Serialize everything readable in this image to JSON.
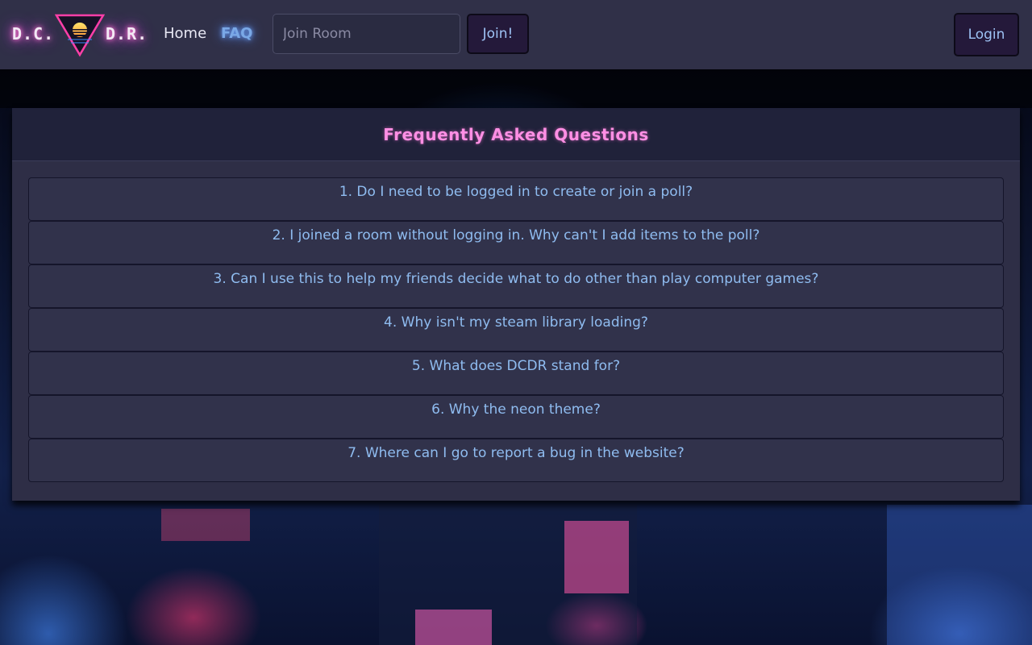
{
  "navbar": {
    "brand_left": "D.C.",
    "brand_right": "D.R.",
    "home_label": "Home",
    "faq_label": "FAQ",
    "join_placeholder": "Join Room",
    "join_button": "Join!",
    "login_button": "Login"
  },
  "faq": {
    "title": "Frequently Asked Questions",
    "questions": [
      "1. Do I need to be logged in to create or join a poll?",
      "2. I joined a room without logging in. Why can't I add items to the poll?",
      "3. Can I use this to help my friends decide what to do other than play computer games?",
      "4. Why isn't my steam library loading?",
      "5. What does DCDR stand for?",
      "6. Why the neon theme?",
      "7. Where can I go to report a bug in the website?"
    ]
  },
  "colors": {
    "navbar_bg": "#303048",
    "accent_pink": "#ff8fe4",
    "accent_blue": "#8fbcf0",
    "card_bg": "#2e2e46"
  },
  "icons": {
    "logo": "neon-sunset-triangle-icon"
  }
}
